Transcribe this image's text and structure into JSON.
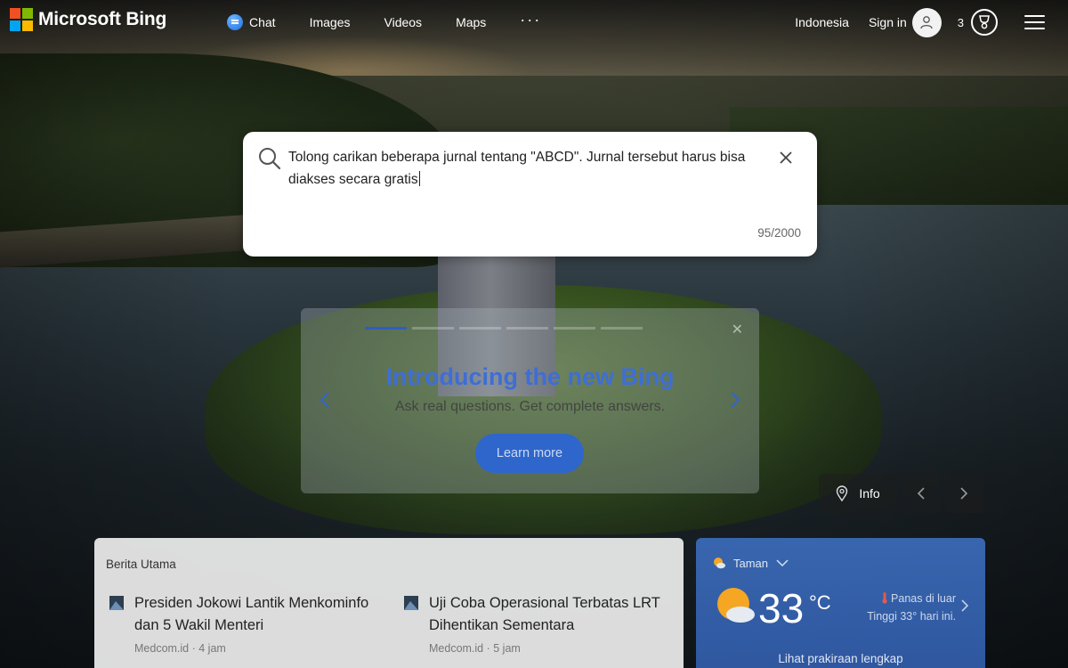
{
  "header": {
    "logo_text": "Microsoft Bing",
    "nav": [
      {
        "label": "Chat",
        "icon": "chat-icon"
      },
      {
        "label": "Images"
      },
      {
        "label": "Videos"
      },
      {
        "label": "Maps"
      },
      {
        "label": "···"
      }
    ],
    "region": "Indonesia",
    "signin_label": "Sign in",
    "rewards_count": "3",
    "brand_colors": [
      "#f25022",
      "#7fba00",
      "#00a4ef",
      "#ffb900"
    ]
  },
  "search": {
    "text": "Tolong carikan beberapa jurnal tentang \"ABCD\". Jurnal tersebut harus bisa diakses secara gratis",
    "char_count": "95/2000"
  },
  "promo": {
    "title": "Introducing the new Bing",
    "subtitle": "Ask real questions. Get complete answers.",
    "button_label": "Learn more",
    "accent_color": "#3e6ed6"
  },
  "image_controls": {
    "info_label": "Info"
  },
  "news": {
    "heading": "Berita Utama",
    "items": [
      {
        "title": "Presiden Jokowi Lantik Menkominfo dan 5 Wakil Menteri",
        "source": "Medcom.id · 4 jam"
      },
      {
        "title": "Uji Coba Operasional Terbatas LRT Dihentikan Sementara",
        "source": "Medcom.id · 5 jam"
      }
    ]
  },
  "weather": {
    "location": "Taman",
    "temperature": "33",
    "unit": "°C",
    "alert_line1": "Panas di luar",
    "alert_line2": "Tinggi 33° hari ini.",
    "forecast_link": "Lihat prakiraan lengkap"
  }
}
